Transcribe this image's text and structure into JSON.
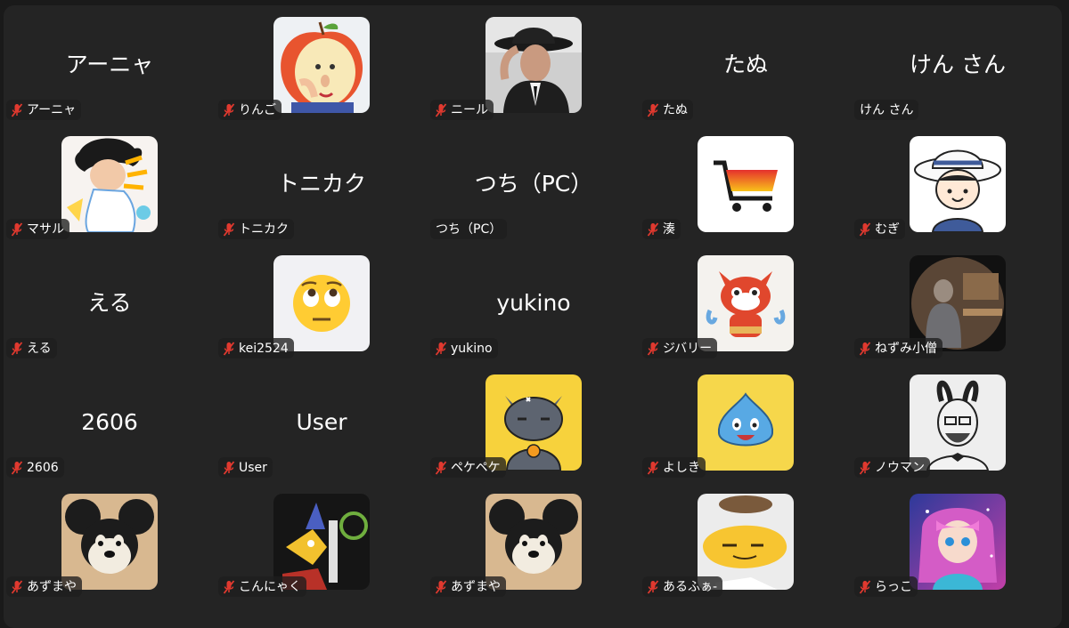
{
  "tiles": [
    {
      "name": "アーニャ",
      "label": "アーニャ",
      "muted": true,
      "avatar": null
    },
    {
      "name": "りんご",
      "label": "りんご",
      "muted": true,
      "avatar": "apple-face-avatar"
    },
    {
      "name": "ニール",
      "label": "ニール",
      "muted": true,
      "avatar": "man-in-fedora-avatar"
    },
    {
      "name": "たぬ",
      "label": "たぬ",
      "muted": true,
      "avatar": null
    },
    {
      "name": "けん さん",
      "label": "けん さん",
      "muted": false,
      "avatar": null
    },
    {
      "name": "マサル",
      "label": "マサル",
      "muted": true,
      "avatar": "anime-character-avatar"
    },
    {
      "name": "トニカク",
      "label": "トニカク",
      "muted": true,
      "avatar": null
    },
    {
      "name": "つち（PC）",
      "label": "つち（PC）",
      "muted": false,
      "avatar": null
    },
    {
      "name": "湊",
      "label": "湊",
      "muted": true,
      "avatar": "shopping-cart-avatar"
    },
    {
      "name": "むぎ",
      "label": "むぎ",
      "muted": true,
      "avatar": "boy-with-hat-avatar"
    },
    {
      "name": "える",
      "label": "える",
      "muted": true,
      "avatar": null
    },
    {
      "name": "kei2524",
      "label": "kei2524",
      "muted": true,
      "avatar": "eye-roll-emoji-avatar"
    },
    {
      "name": "yukino",
      "label": "yukino",
      "muted": true,
      "avatar": null
    },
    {
      "name": "ジバリー",
      "label": "ジバリー",
      "muted": true,
      "avatar": "red-cat-yokai-avatar"
    },
    {
      "name": "ねずみ小僧",
      "label": "ねずみ小僧",
      "muted": true,
      "avatar": "person-in-kitchen-avatar"
    },
    {
      "name": "2606",
      "label": "2606",
      "muted": true,
      "avatar": null
    },
    {
      "name": "User",
      "label": "User",
      "muted": true,
      "avatar": null
    },
    {
      "name": "ペケペケ",
      "label": "ペケペケ",
      "muted": true,
      "avatar": "gray-cat-avatar"
    },
    {
      "name": "よしき",
      "label": "よしき",
      "muted": true,
      "avatar": "blue-slime-avatar"
    },
    {
      "name": "ノウマン",
      "label": "ノウマン",
      "muted": true,
      "avatar": "bunny-ears-man-avatar"
    },
    {
      "name": "あずまや",
      "label": "あずまや",
      "muted": true,
      "avatar": "mouse-plush-avatar"
    },
    {
      "name": "こんにゃく",
      "label": "こんにゃく",
      "muted": true,
      "avatar": "robot-bird-avatar"
    },
    {
      "name": "あずまや",
      "label": "あずまや",
      "muted": true,
      "avatar": "mouse-plush-avatar"
    },
    {
      "name": "あるふぁ-",
      "label": "あるふぁ-",
      "muted": true,
      "avatar": "yellow-egg-plush-avatar"
    },
    {
      "name": "らっこ",
      "label": "らっこ",
      "muted": true,
      "avatar": "anime-girl-avatar"
    }
  ],
  "colors": {
    "background": "#1a1a1a",
    "gallery": "#242424",
    "mute_icon": "#e0392f",
    "text": "#ffffff"
  }
}
